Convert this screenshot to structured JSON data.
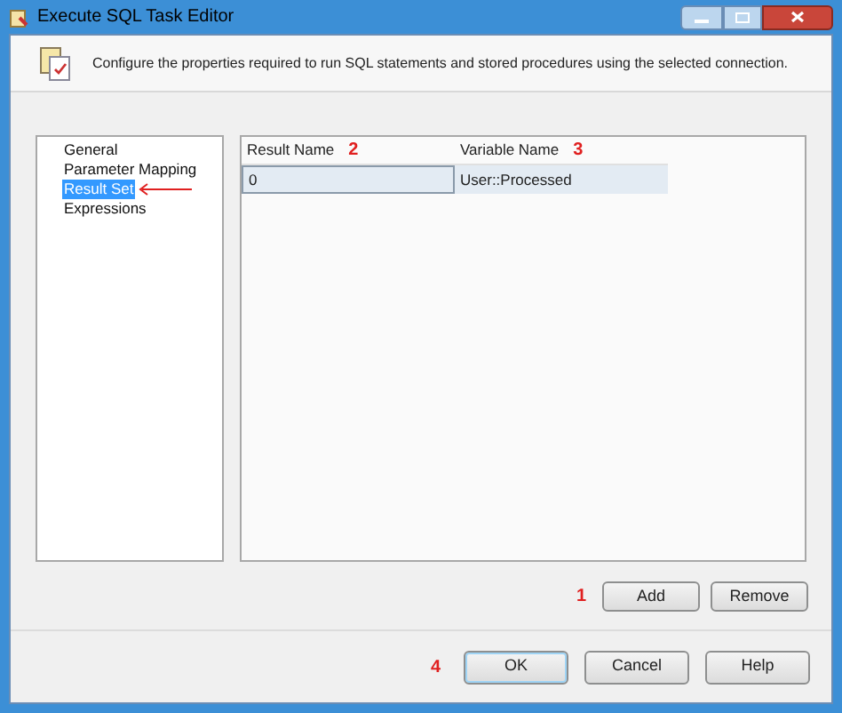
{
  "window": {
    "title": "Execute SQL Task Editor"
  },
  "header": {
    "description": "Configure the properties required to run SQL statements and stored procedures using the selected connection."
  },
  "nav": {
    "items": [
      {
        "label": "General",
        "selected": false
      },
      {
        "label": "Parameter Mapping",
        "selected": false
      },
      {
        "label": "Result Set",
        "selected": true
      },
      {
        "label": "Expressions",
        "selected": false
      }
    ]
  },
  "table": {
    "columns": [
      {
        "label": "Result Name",
        "marker": "2"
      },
      {
        "label": "Variable Name",
        "marker": "3"
      }
    ],
    "rows": [
      [
        "0",
        "User::Processed"
      ]
    ]
  },
  "grid_buttons": {
    "marker": "1",
    "items": [
      "Add",
      "Remove"
    ]
  },
  "dialog_buttons": {
    "marker": "4",
    "items": [
      {
        "label": "OK",
        "selected": true
      },
      {
        "label": "Cancel",
        "selected": false
      },
      {
        "label": "Help",
        "selected": false
      }
    ]
  }
}
